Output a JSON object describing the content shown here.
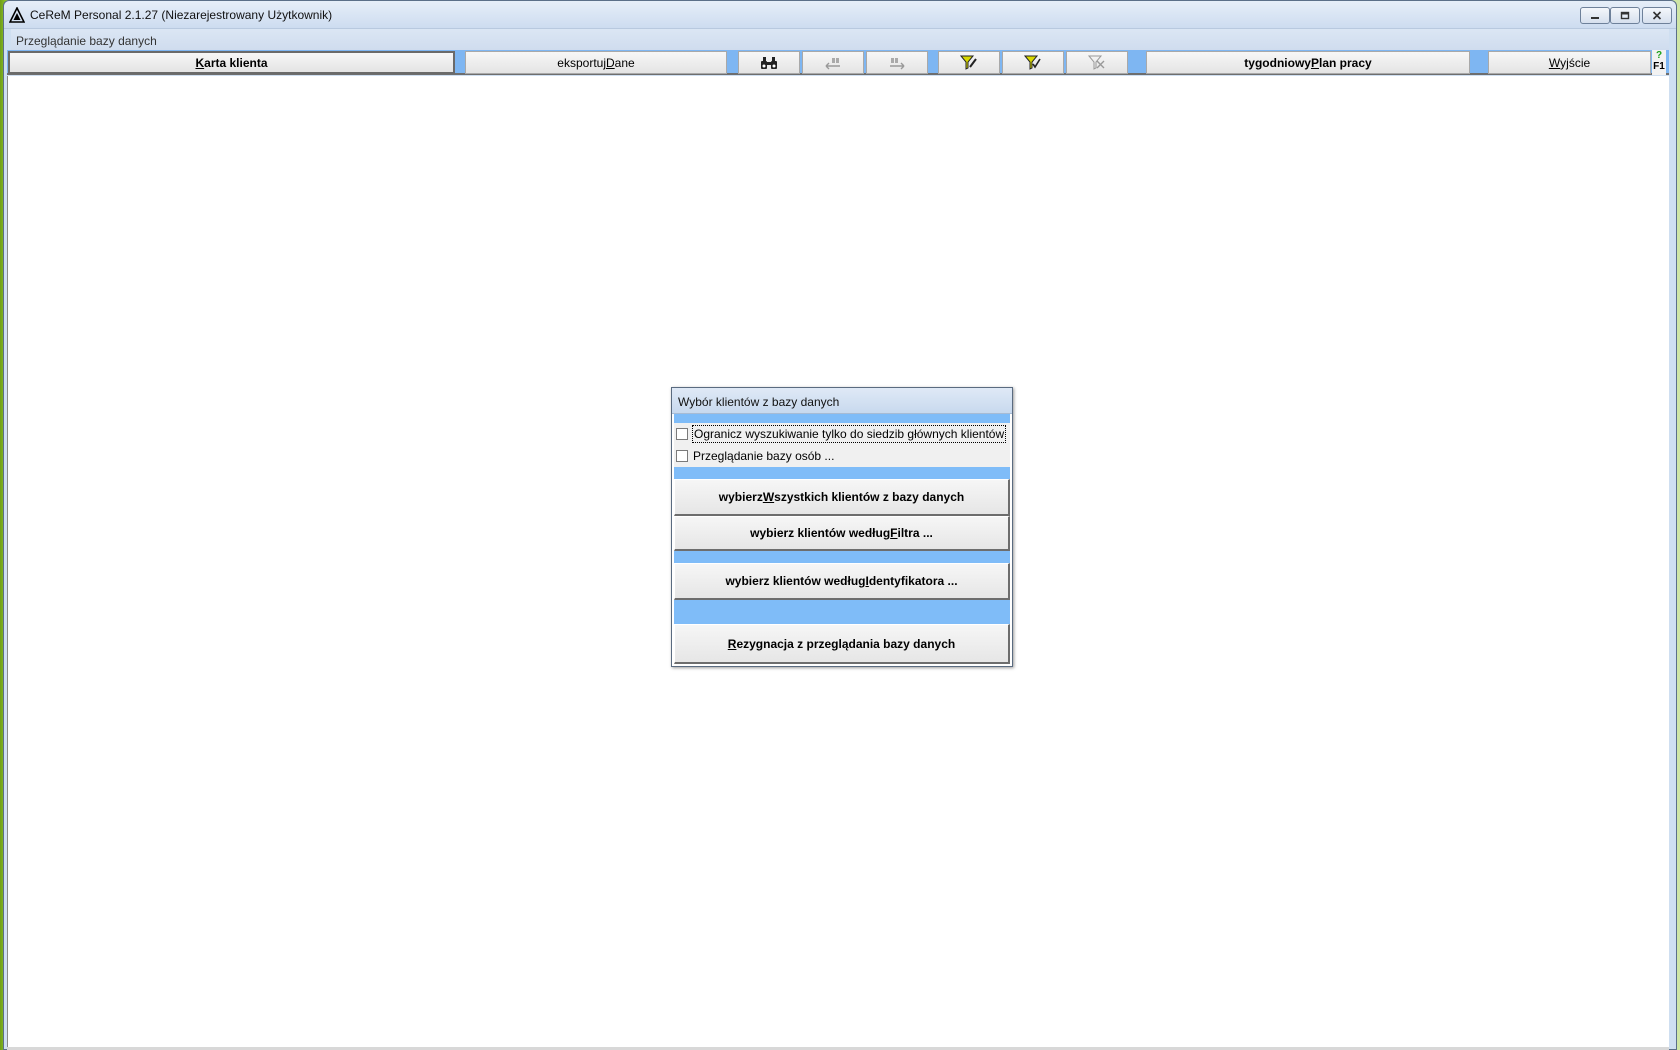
{
  "window": {
    "title": "CeReM Personal 2.1.27 (Niezarejestrowany Użytkownik)",
    "icons": {
      "app": "cerem-triangle-icon",
      "minimize": "minimize-icon",
      "maximize": "restore-icon",
      "close": "close-icon"
    }
  },
  "submenu": {
    "label": "Przeglądanie bazy danych"
  },
  "toolbar": {
    "karta_klienta": {
      "pre": "",
      "key": "K",
      "post": "arta klienta"
    },
    "eksportuj_dane": {
      "pre": "eksportuj ",
      "key": "D",
      "post": "ane"
    },
    "icons": {
      "search": "binoculars-icon",
      "prev": "previous-record-icon",
      "next": "next-record-icon",
      "filter_set": "filter-edit-icon",
      "filter_apply": "filter-apply-icon",
      "filter_clear": "filter-clear-icon"
    },
    "plan_pracy": {
      "pre": "tygodniowy ",
      "key": "P",
      "post": "lan pracy"
    },
    "wyjscie": {
      "pre": "",
      "key": "W",
      "post": "yjście"
    },
    "help": {
      "mark": "?",
      "key": "F1"
    }
  },
  "dialog": {
    "title": "Wybór klientów z bazy danych",
    "checkbox_main_only": {
      "label": "Ogranicz wyszukiwanie tylko do siedzib głównych klientów",
      "checked": false
    },
    "checkbox_persons": {
      "label": "Przeglądanie bazy osób ...",
      "checked": false
    },
    "btn_all": {
      "pre": "wybierz ",
      "key": "W",
      "post": "szystkich klientów z bazy danych"
    },
    "btn_filter": {
      "pre": "wybierz klientów według ",
      "key": "F",
      "post": "iltra ..."
    },
    "btn_id": {
      "pre": "wybierz klientów według ",
      "key": "I",
      "post": "dentyfikatora ..."
    },
    "btn_cancel": {
      "pre": "",
      "key": "R",
      "post": "ezygnacja z przeglądania bazy danych"
    }
  },
  "colors": {
    "accent_blue": "#7fbcf8",
    "desktop_green": "#8fc52a"
  }
}
